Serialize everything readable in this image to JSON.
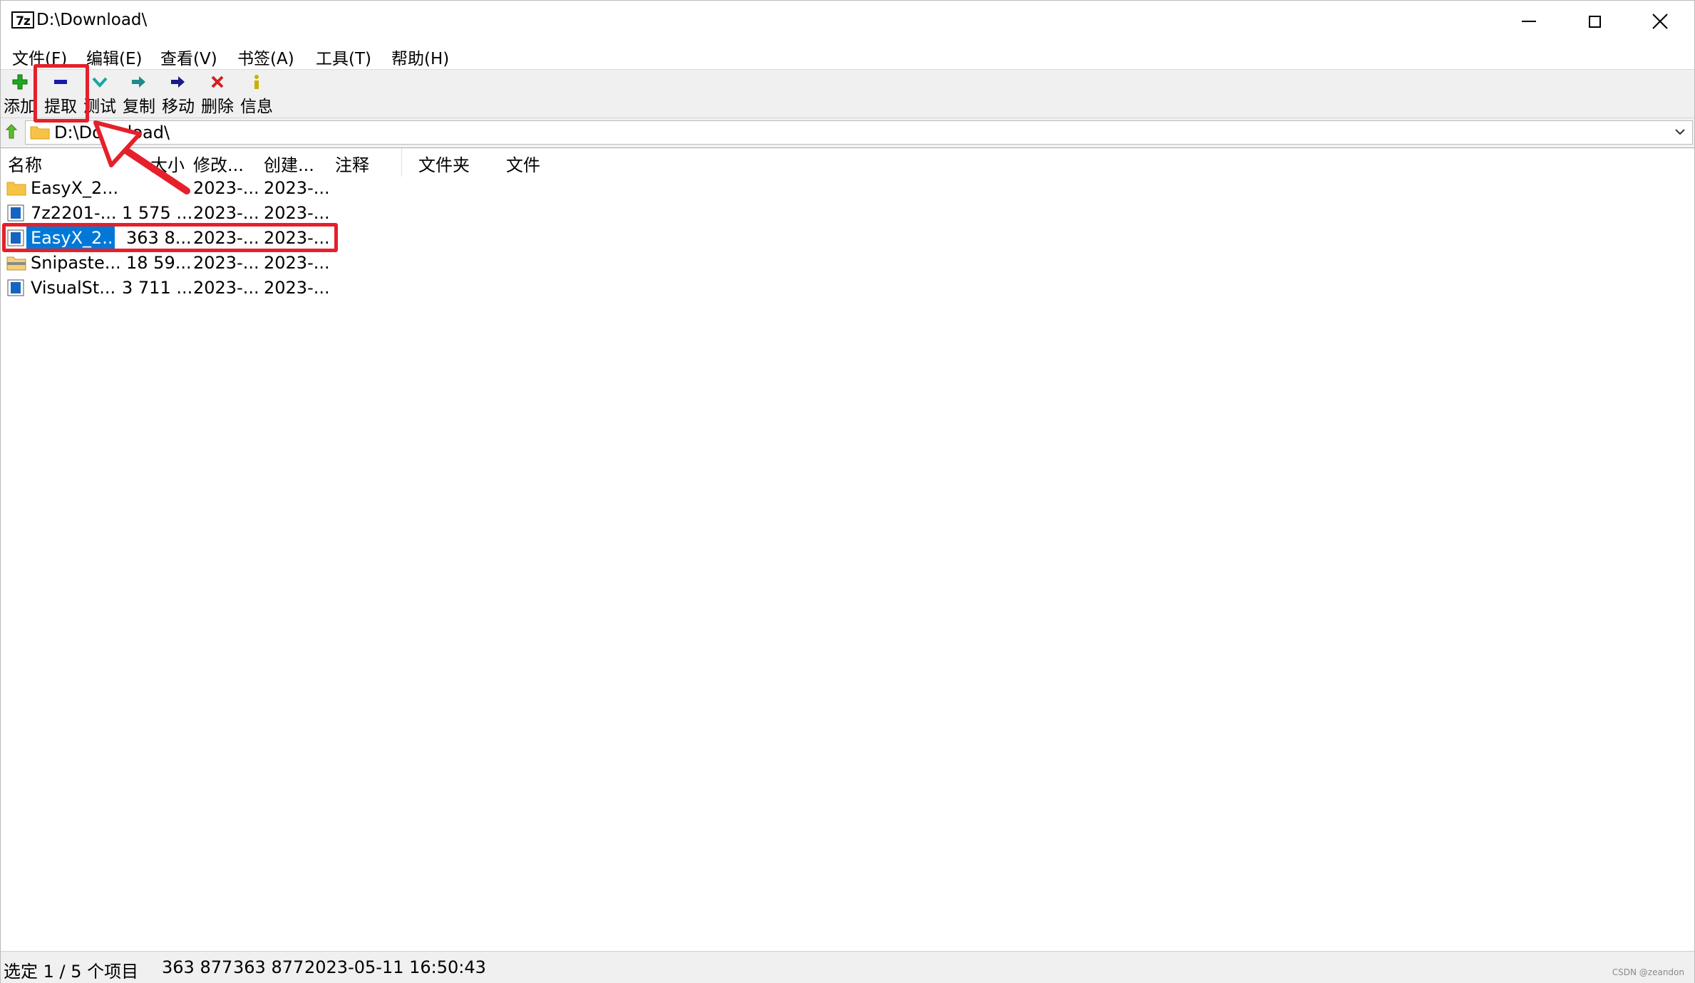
{
  "window": {
    "title": "D:\\Download\\",
    "app_icon_text": "7z"
  },
  "menu": [
    {
      "label": "文件(F)"
    },
    {
      "label": "编辑(E)"
    },
    {
      "label": "查看(V)"
    },
    {
      "label": "书签(A)"
    },
    {
      "label": "工具(T)"
    },
    {
      "label": "帮助(H)"
    }
  ],
  "toolbar": [
    {
      "label": "添加",
      "icon": "add-icon",
      "color": "#1ea81e"
    },
    {
      "label": "提取",
      "icon": "extract-icon",
      "color": "#1a1aa8"
    },
    {
      "label": "测试",
      "icon": "test-icon",
      "color": "#18a5a5"
    },
    {
      "label": "复制",
      "icon": "copy-icon",
      "color": "#1f8a8a"
    },
    {
      "label": "移动",
      "icon": "move-icon",
      "color": "#1a1a8a"
    },
    {
      "label": "删除",
      "icon": "delete-icon",
      "color": "#d42020"
    },
    {
      "label": "信息",
      "icon": "info-icon",
      "color": "#c9b000"
    }
  ],
  "address": {
    "path": "D:\\Download\\"
  },
  "columns": [
    "名称",
    "大小",
    "修改...",
    "创建...",
    "注释",
    "文件夹",
    "文件"
  ],
  "rows": [
    {
      "icon": "folder-icon",
      "name": "EasyX_2...",
      "size": "",
      "modified": "2023-...",
      "created": "2023-...",
      "selected": false
    },
    {
      "icon": "exe-file-icon",
      "name": "7z2201-...",
      "size": "1 575 ...",
      "modified": "2023-...",
      "created": "2023-...",
      "selected": false
    },
    {
      "icon": "exe-file-icon",
      "name": "EasyX_2...",
      "size": "363 8...",
      "modified": "2023-...",
      "created": "2023-...",
      "selected": true
    },
    {
      "icon": "zip-archive-icon",
      "name": "Snipaste...",
      "size": "18 59...",
      "modified": "2023-...",
      "created": "2023-...",
      "selected": false
    },
    {
      "icon": "exe-file-icon",
      "name": "VisualSt...",
      "size": "3 711 ...",
      "modified": "2023-...",
      "created": "2023-...",
      "selected": false
    }
  ],
  "status": {
    "selection": "选定 1 / 5 个项目",
    "size": "363 877",
    "packed_size": "363 877",
    "datetime": "2023-05-11 16:50:43"
  },
  "watermark": "CSDN @zeandon",
  "colors": {
    "selection": "#0078d7",
    "annotation": "#e5202a",
    "toolbar_bg": "#f0f0f0"
  }
}
